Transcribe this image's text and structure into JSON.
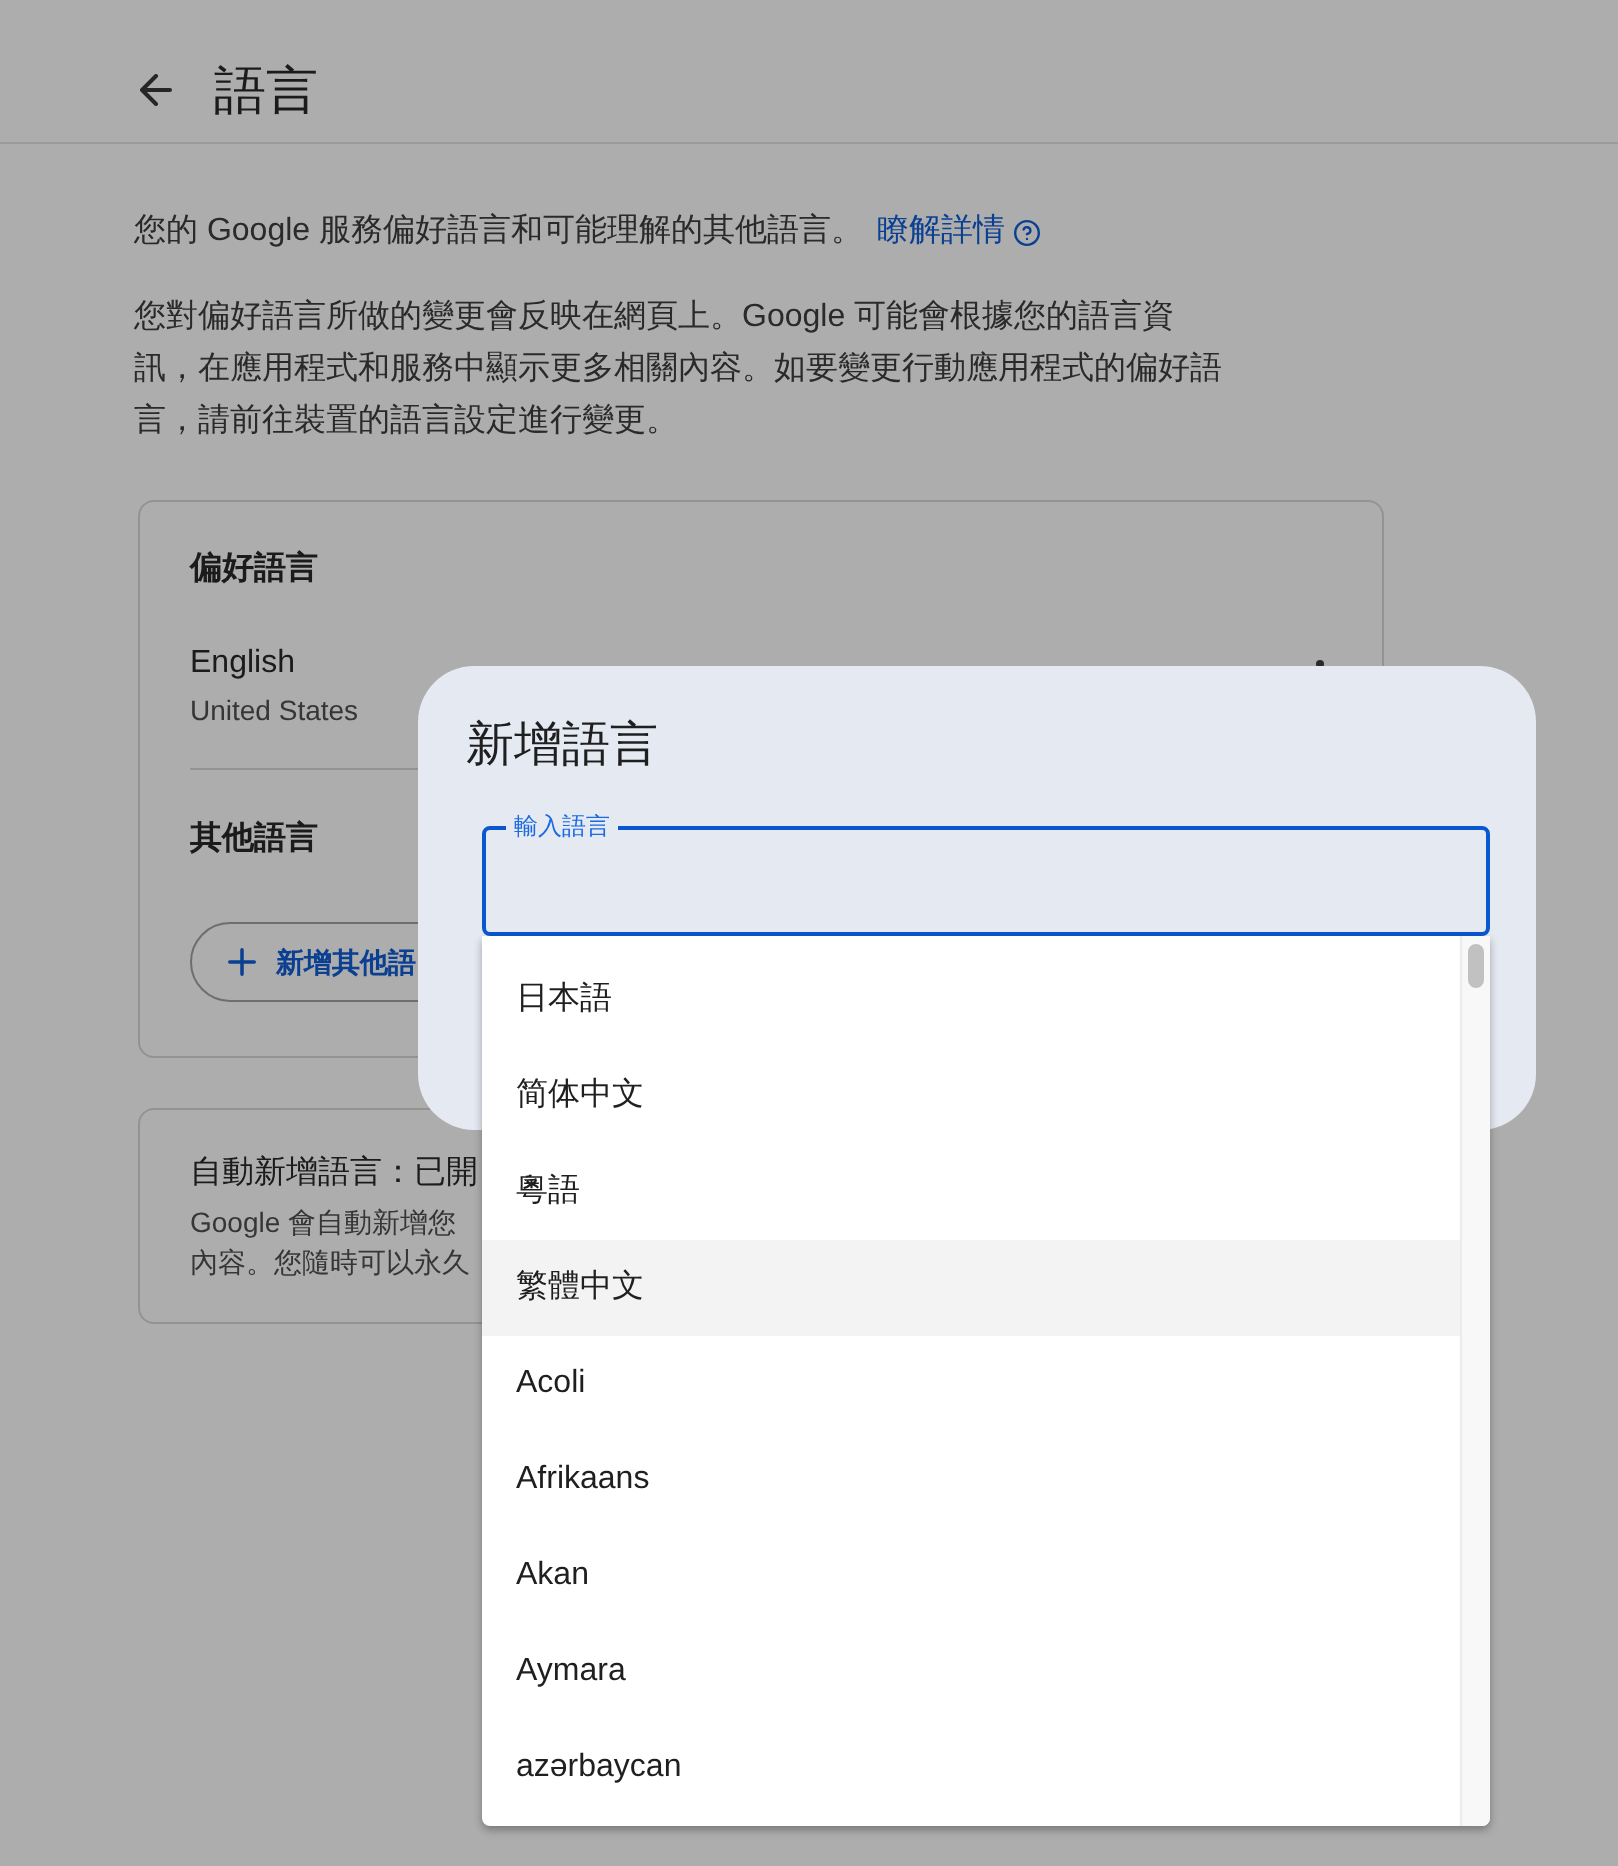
{
  "header": {
    "title": "語言"
  },
  "intro": {
    "text": "您的 Google 服務偏好語言和可能理解的其他語言。",
    "link": "瞭解詳情"
  },
  "note": "您對偏好語言所做的變更會反映在網頁上。Google 可能會根據您的語言資訊，在應用程式和服務中顯示更多相關內容。如要變更行動應用程式的偏好語言，請前往裝置的語言設定進行變更。",
  "preferred_card": {
    "title": "偏好語言",
    "language": {
      "name": "English",
      "region": "United States"
    },
    "other_title": "其他語言",
    "add_button": "新增其他語"
  },
  "auto_card": {
    "title": "自動新增語言：已開",
    "lines": [
      "Google 會自動新增您",
      "內容。您隨時可以永久"
    ]
  },
  "dialog": {
    "title": "新增語言",
    "field": {
      "label": "輸入語言"
    },
    "options": [
      {
        "label": "日本語",
        "selected": false
      },
      {
        "label": "简体中文",
        "selected": false
      },
      {
        "label": "粵語",
        "selected": false
      },
      {
        "label": "繁體中文",
        "selected": true
      },
      {
        "label": "Acoli",
        "selected": false
      },
      {
        "label": "Afrikaans",
        "selected": false
      },
      {
        "label": "Akan",
        "selected": false
      },
      {
        "label": "Aymara",
        "selected": false
      },
      {
        "label": "azərbaycan",
        "selected": false
      }
    ]
  }
}
